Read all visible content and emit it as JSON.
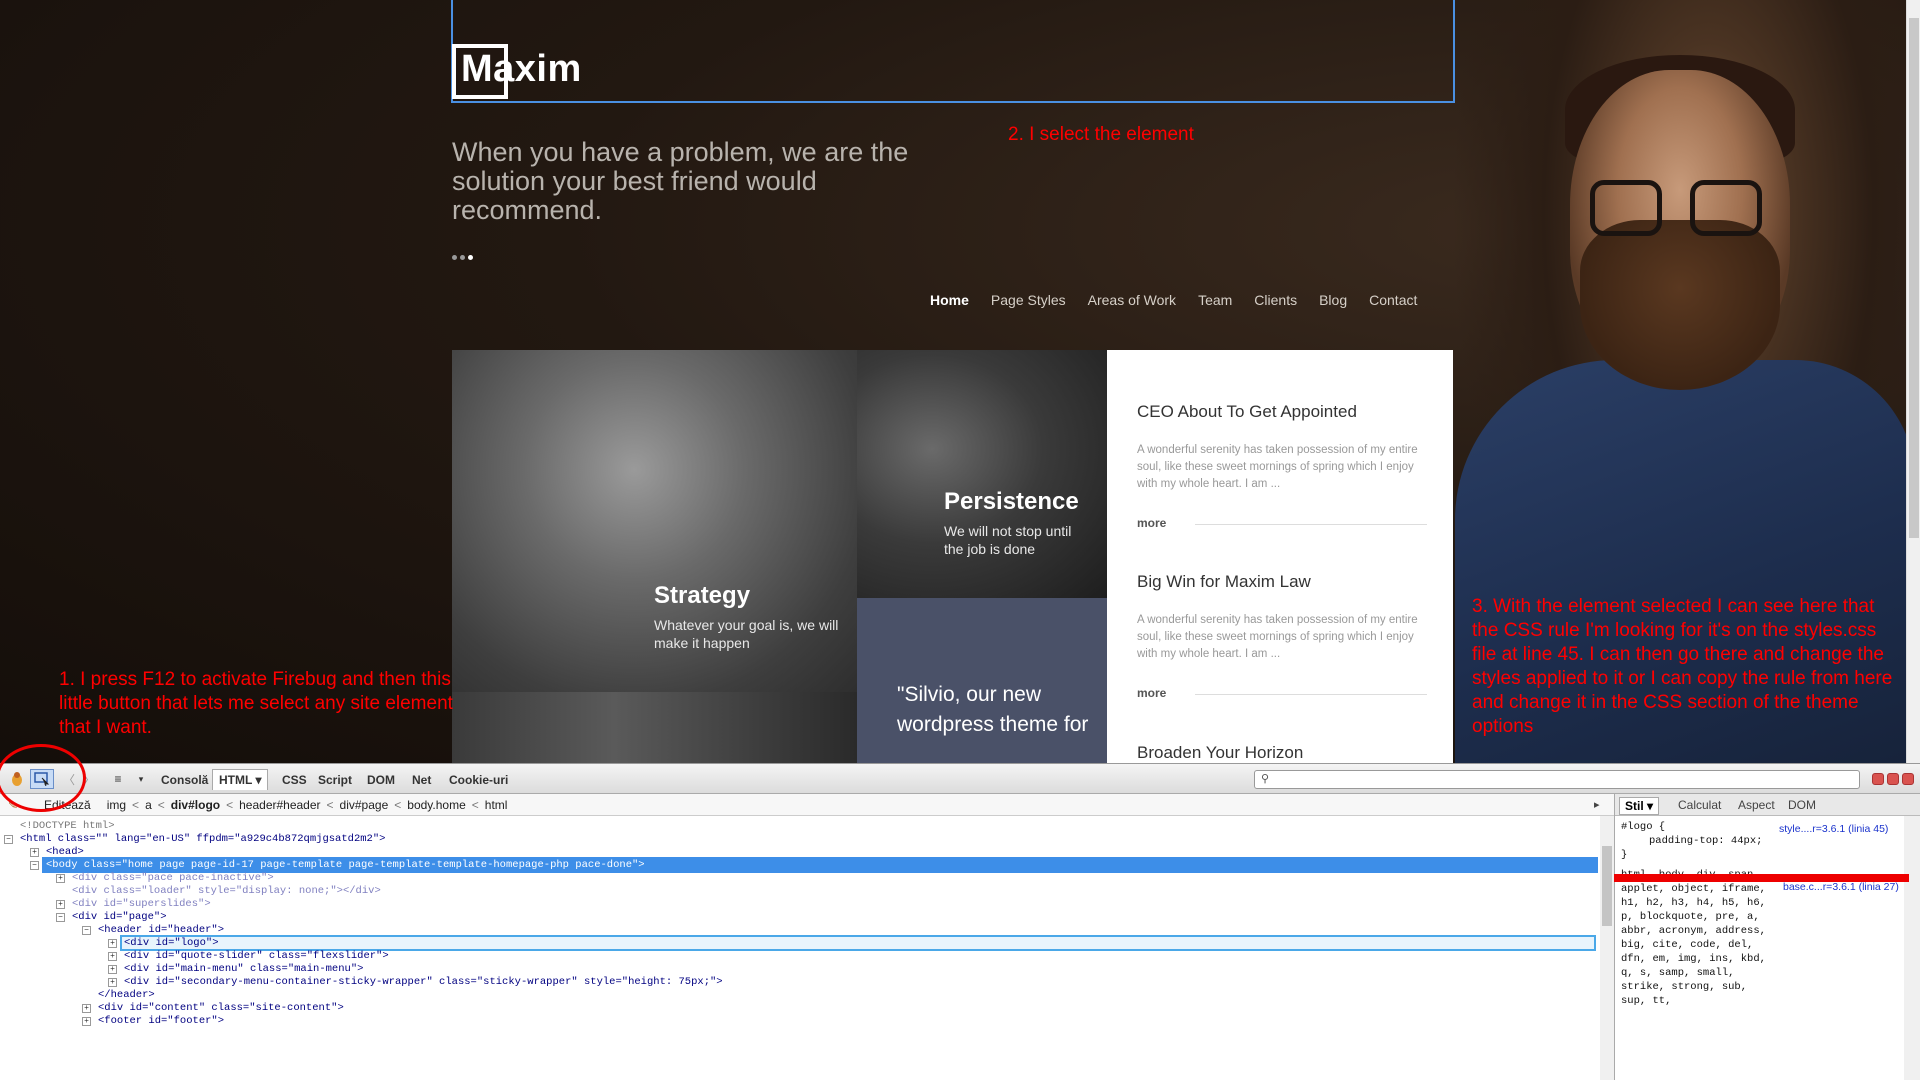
{
  "site": {
    "logo": "Maxim",
    "tagline": "When you have a problem, we are the solution your best friend would recommend.",
    "nav": [
      "Home",
      "Page Styles",
      "Areas of Work",
      "Team",
      "Clients",
      "Blog",
      "Contact"
    ],
    "tiles": {
      "strategy_title": "Strategy",
      "strategy_sub": "Whatever your goal is, we will make it happen",
      "persistence_title": "Persistence",
      "persistence_sub": "We will not stop until the job is done",
      "quote": "\"Silvio, our new wordpress theme for"
    },
    "posts": [
      {
        "title": "CEO About To Get Appointed",
        "excerpt": "A wonderful serenity has taken possession of my entire soul, like these sweet mornings of spring which I enjoy with my whole heart. I am ...",
        "more": "more"
      },
      {
        "title": "Big Win for Maxim Law",
        "excerpt": "A wonderful serenity has taken possession of my entire soul, like these sweet mornings of spring which I enjoy with my whole heart. I am ...",
        "more": "more"
      },
      {
        "title": "Broaden Your Horizon"
      }
    ]
  },
  "annotations": {
    "step1": "1. I press F12 to activate Firebug and then this little button that lets me select any site element that I want.",
    "step2": "2. I select the element",
    "step3": "3. With the element selected I can see here that the CSS rule I'm looking for it's on the styles.css file at line 45. I can then go there and change the styles applied to it or I can copy the rule from here and change it in the CSS section of the theme options"
  },
  "firebug": {
    "tabs": [
      "Consolă",
      "HTML ▾",
      "CSS",
      "Script",
      "DOM",
      "Net",
      "Cookie-uri"
    ],
    "breadcrumb": {
      "edit": "Editează",
      "path": [
        "img",
        "a",
        "div#logo",
        "header#header",
        "div#page",
        "body.home",
        "html"
      ]
    },
    "side_tabs": [
      "Stil ▾",
      "Calculat",
      "Aspect",
      "DOM"
    ],
    "html_lines": [
      "<!DOCTYPE html>",
      "<html class=\"\" lang=\"en-US\" ffpdm=\"a929c4b872qmjgsatd2m2\">",
      "<head>",
      "<body class=\"home page page-id-17 page-template page-template-template-homepage-php pace-done\">",
      "<div class=\"pace pace-inactive\">",
      "<div class=\"loader\" style=\"display: none;\"></div>",
      "<div id=\"superslides\">",
      "<div id=\"page\">",
      "<header id=\"header\">",
      "<div id=\"logo\">",
      "<div id=\"quote-slider\" class=\"flexslider\">",
      "<div id=\"main-menu\" class=\"main-menu\">",
      "<div id=\"secondary-menu-container-sticky-wrapper\" class=\"sticky-wrapper\" style=\"height: 75px;\">",
      "</header>",
      "<div id=\"content\" class=\"site-content\">",
      "<footer id=\"footer\">"
    ],
    "css": {
      "rule1_selector": "#logo {",
      "rule1_decl": "padding-top: 44px;",
      "rule1_close": "}",
      "rule1_source": "style....r=3.6.1 (linia 45)",
      "rule2_selector": "html, body, div, span, applet, object, iframe, h1, h2, h3, h4, h5, h6, p, blockquote, pre, a, abbr, acronym, address, big, cite, code, del, dfn, em, img, ins, kbd, q, s, samp, small, strike, strong, sub, sup, tt,",
      "rule2_source": "base.c...r=3.6.1 (linia 27)"
    }
  }
}
